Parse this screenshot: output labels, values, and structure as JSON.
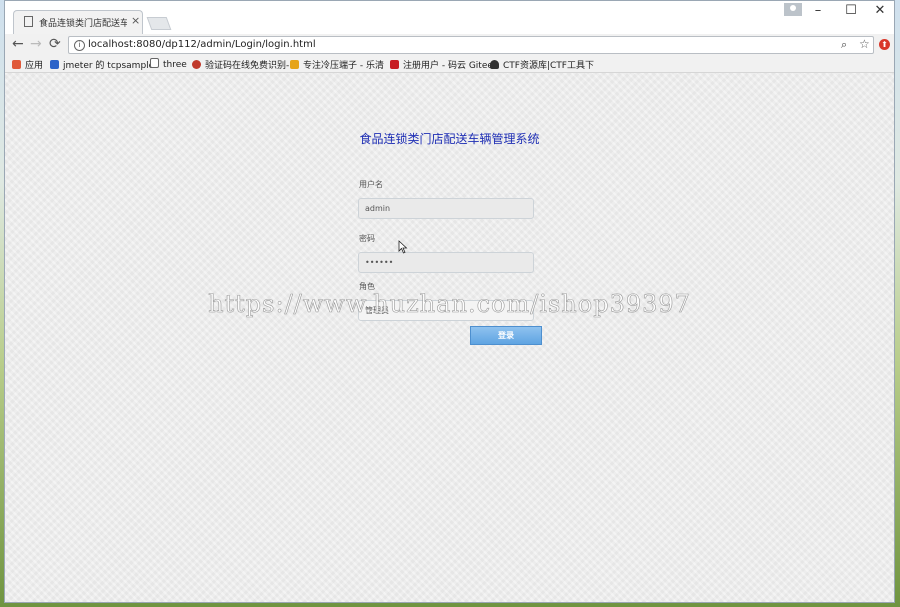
{
  "browser": {
    "tab_title": "食品连锁类门店配送车辆",
    "tab_close": "×",
    "window_controls": {
      "minimize": "–",
      "maximize": "☐",
      "close": "✕"
    },
    "url": "localhost:8080/dp112/admin/Login/login.html",
    "nav": {
      "back": "←",
      "forward": "→",
      "reload": "⟳"
    },
    "icons": {
      "info": "i",
      "zoom": "⌕",
      "star": "☆",
      "extension": "⬆"
    }
  },
  "bookmarks": [
    {
      "label": "应用",
      "icon": "apps-grid",
      "color": "#e05a3a"
    },
    {
      "label": "jmeter 的 tcpsample",
      "icon": "shield",
      "color": "#2b63c9"
    },
    {
      "label": "three",
      "icon": "page",
      "color": "#666666"
    },
    {
      "label": "验证码在线免费识别-",
      "icon": "site",
      "color": "#c0392b"
    },
    {
      "label": "专注冷压端子 - 乐清",
      "icon": "site",
      "color": "#e6a419"
    },
    {
      "label": "注册用户 - 码云 Gitee",
      "icon": "gitee",
      "color": "#c71d23"
    },
    {
      "label": "CTF资源库|CTF工具下",
      "icon": "person",
      "color": "#333333"
    }
  ],
  "login": {
    "system_title": "食品连锁类门店配送车辆管理系统",
    "username_label": "用户名",
    "username_value": "admin",
    "password_label": "密码",
    "password_value": "••••••",
    "role_label": "角色",
    "role_value": "管理员",
    "submit_label": "登录"
  },
  "watermark": "https://www.huzhan.com/ishop39397"
}
